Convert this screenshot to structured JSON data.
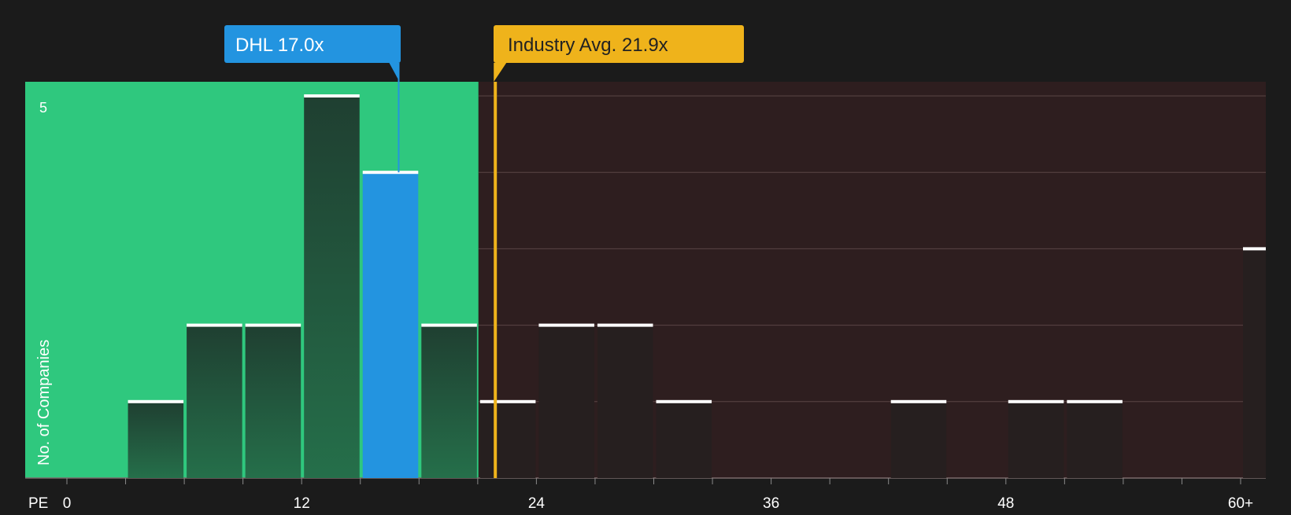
{
  "colors": {
    "background": "#1b1b1b",
    "fair_zone": "#2fc87e",
    "expensive_zone": "#2e1e1f",
    "bar_dark_top": "#1f3f31",
    "bar_dark_bottom": "#256f4a",
    "bar_expensive": "#261f1f",
    "bar_highlight": "#2394e0",
    "bar_cap": "#ffffff",
    "industry": "#efb31b",
    "grid": "#5a4545",
    "axis_text": "#ffffff"
  },
  "chart_data": {
    "type": "bar",
    "x_axis_label": "PE",
    "y_axis_label": "No. of Companies",
    "x_ticks": [
      "0",
      "12",
      "24",
      "36",
      "48",
      "60+"
    ],
    "y_ticks": [
      "5"
    ],
    "xlim": [
      0,
      61.5
    ],
    "ylim": [
      0,
      5
    ],
    "bar_width": 3,
    "fair_value_max": 21,
    "bars": [
      {
        "x_start": 3,
        "value": 1
      },
      {
        "x_start": 6,
        "value": 2
      },
      {
        "x_start": 9,
        "value": 2
      },
      {
        "x_start": 12,
        "value": 5
      },
      {
        "x_start": 15,
        "value": 4,
        "highlight": true
      },
      {
        "x_start": 18,
        "value": 2
      },
      {
        "x_start": 21,
        "value": 1
      },
      {
        "x_start": 24,
        "value": 2
      },
      {
        "x_start": 27,
        "value": 2
      },
      {
        "x_start": 30,
        "value": 1
      },
      {
        "x_start": 42,
        "value": 1
      },
      {
        "x_start": 48,
        "value": 1
      },
      {
        "x_start": 51,
        "value": 1
      },
      {
        "x_start": 60,
        "value": 3
      }
    ],
    "company_marker": {
      "label": "DHL 17.0x",
      "value": 17.0
    },
    "industry_marker": {
      "label": "Industry Avg. 21.9x",
      "value": 21.9
    }
  }
}
